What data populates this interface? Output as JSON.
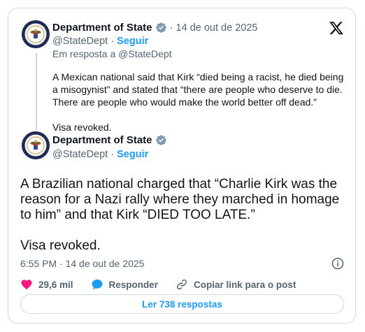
{
  "reply_tweet": {
    "author_name": "Department of State",
    "handle": "@StateDept",
    "separator": "·",
    "follow_label": "Seguir",
    "date": "14 de out de 2025",
    "in_reply_to": "Em resposta a @StateDept",
    "text": "A Mexican national said that Kirk “died being a racist, he died being a misogynist” and stated that “there are people who deserve to die. There are people who would make the world better off dead.”\n\nVisa revoked."
  },
  "main_tweet": {
    "author_name": "Department of State",
    "handle": "@StateDept",
    "separator": "·",
    "follow_label": "Seguir",
    "text": "A Brazilian national charged that “Charlie Kirk was the reason for a Nazi rally where they marched in homage to him” and that Kirk “DIED TOO LATE.”\n\nVisa revoked.",
    "timestamp": "6:55 PM · 14 de out de 2025"
  },
  "actions": {
    "likes": "29,6 mil",
    "reply_label": "Responder",
    "copy_link_label": "Copiar link para o post"
  },
  "read_replies_label": "Ler 738 respostas",
  "icons": {
    "brand": "x-logo-icon",
    "verified": "verified-badge-icon",
    "info": "info-icon",
    "like": "heart-icon",
    "reply": "speech-bubble-icon",
    "link": "link-icon"
  },
  "colors": {
    "accent": "#1d9bf0",
    "like": "#f91880",
    "text": "#0f1419",
    "muted": "#536471",
    "border": "#cfd9de",
    "verified_badge": "#829aab"
  }
}
